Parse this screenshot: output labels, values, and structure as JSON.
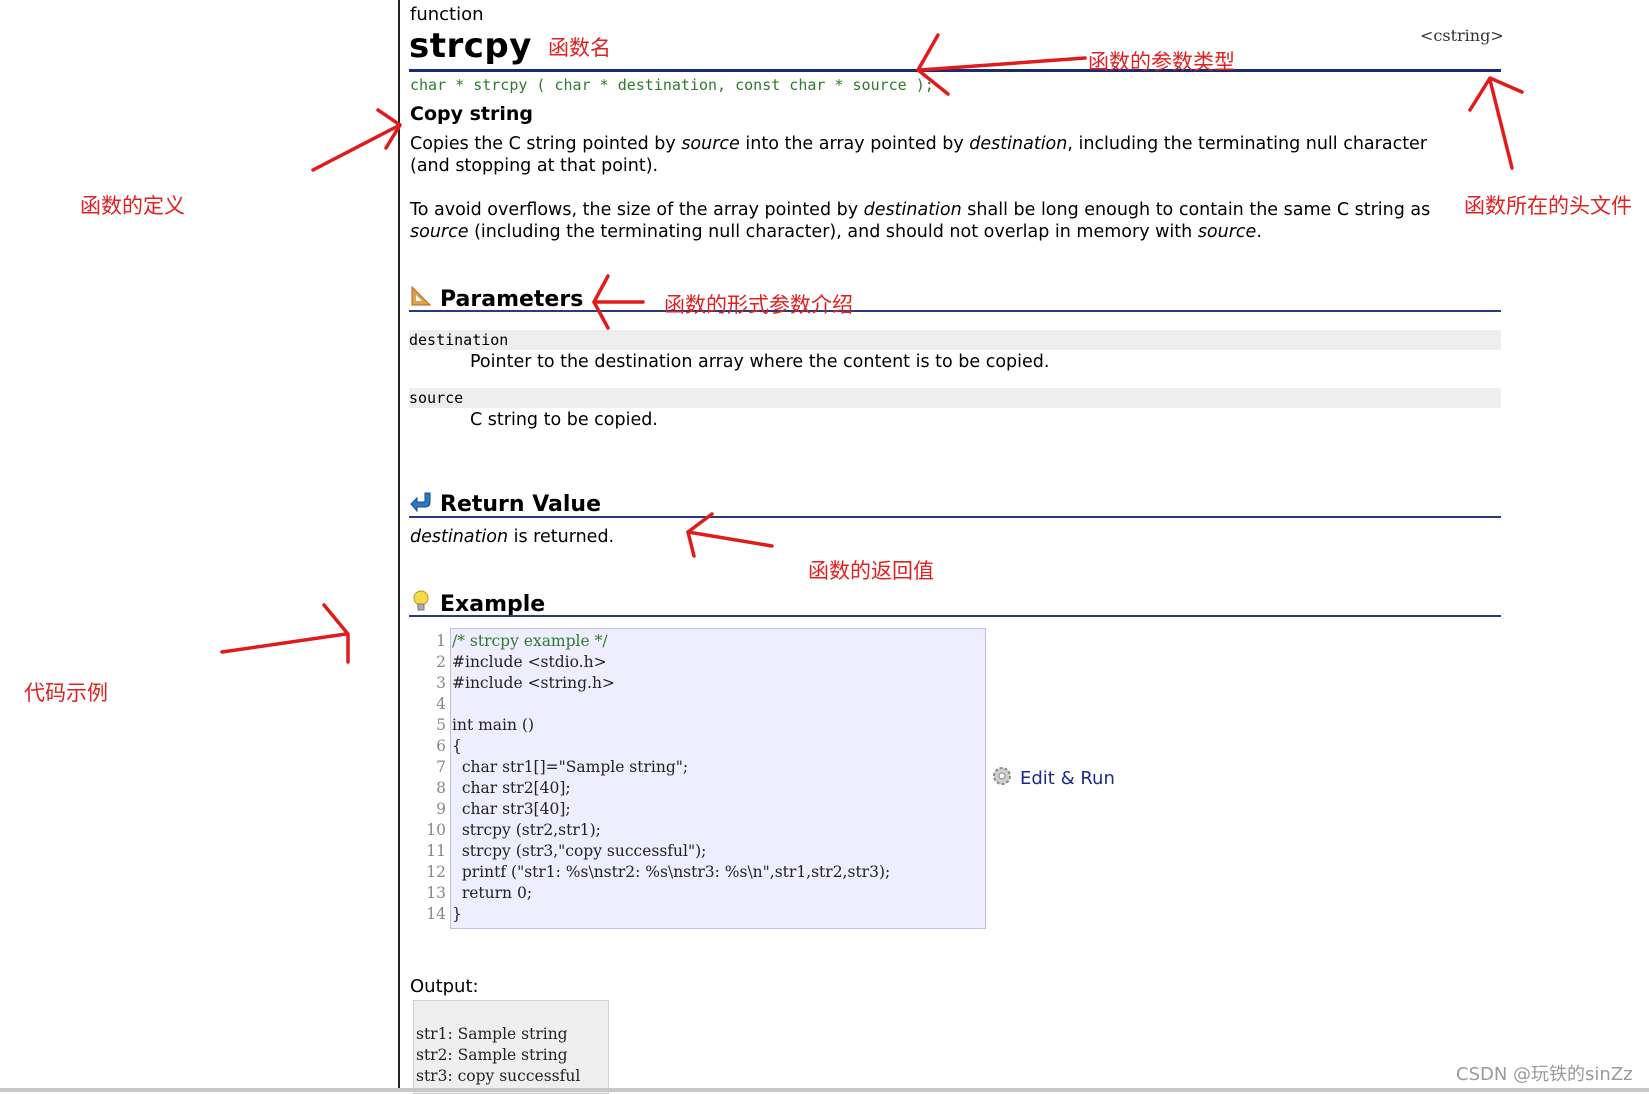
{
  "reference": {
    "kind": "function",
    "name": "strcpy",
    "header": "<cstring>",
    "signature": "char * strcpy ( char * destination, const char * source );",
    "short_desc": "Copy string"
  },
  "description": {
    "p1": [
      {
        "t": "Copies the C string pointed by ",
        "i": false
      },
      {
        "t": "source",
        "i": true
      },
      {
        "t": " into the array pointed by ",
        "i": false
      },
      {
        "t": "destination",
        "i": true
      },
      {
        "t": ", including the terminating null character (and stopping at that point).",
        "i": false
      }
    ],
    "p2": [
      {
        "t": "To avoid overflows, the size of the array pointed by ",
        "i": false
      },
      {
        "t": "destination",
        "i": true
      },
      {
        "t": " shall be long enough to contain the same C string as ",
        "i": false
      },
      {
        "t": "source",
        "i": true
      },
      {
        "t": " (including the terminating null character), and should not overlap in memory with ",
        "i": false
      },
      {
        "t": "source",
        "i": true
      },
      {
        "t": ".",
        "i": false
      }
    ]
  },
  "sections": {
    "parameters": "Parameters",
    "return_value": "Return Value",
    "example": "Example"
  },
  "parameters": [
    {
      "name": "destination",
      "desc": "Pointer to the destination array where the content is to be copied."
    },
    {
      "name": "source",
      "desc": "C string to be copied."
    }
  ],
  "return_value": {
    "term": "destination",
    "rest": " is returned."
  },
  "example": {
    "line_numbers": [
      "1",
      "2",
      "3",
      "4",
      "5",
      "6",
      "7",
      "8",
      "9",
      "10",
      "11",
      "12",
      "13",
      "14"
    ],
    "code": [
      "/* strcpy example */",
      "#include <stdio.h>",
      "#include <string.h>",
      "",
      "int main ()",
      "{",
      "  char str1[]=\"Sample string\";",
      "  char str2[40];",
      "  char str3[40];",
      "  strcpy (str2,str1);",
      "  strcpy (str3,\"copy successful\");",
      "  printf (\"str1: %s\\nstr2: %s\\nstr3: %s\\n\",str1,str2,str3);",
      "  return 0;",
      "}"
    ],
    "edit_run_label": "Edit & Run",
    "output_label": "Output:",
    "output": [
      "str1: Sample string",
      "str2: Sample string",
      "str3: copy successful"
    ]
  },
  "annotations": {
    "name": "函数名",
    "param_type": "函数的参数类型",
    "header": "函数所在的头文件",
    "definition": "函数的定义",
    "params": "函数的形式参数介绍",
    "return": "函数的返回值",
    "example": "代码示例",
    "color": "#e12020"
  },
  "watermark": "CSDN @玩铁的sinZz",
  "colors": {
    "rule": "#1a2b6b",
    "signature": "#2f7a2f",
    "code_bg": "#eeeeff",
    "link": "#1a2b8a"
  }
}
